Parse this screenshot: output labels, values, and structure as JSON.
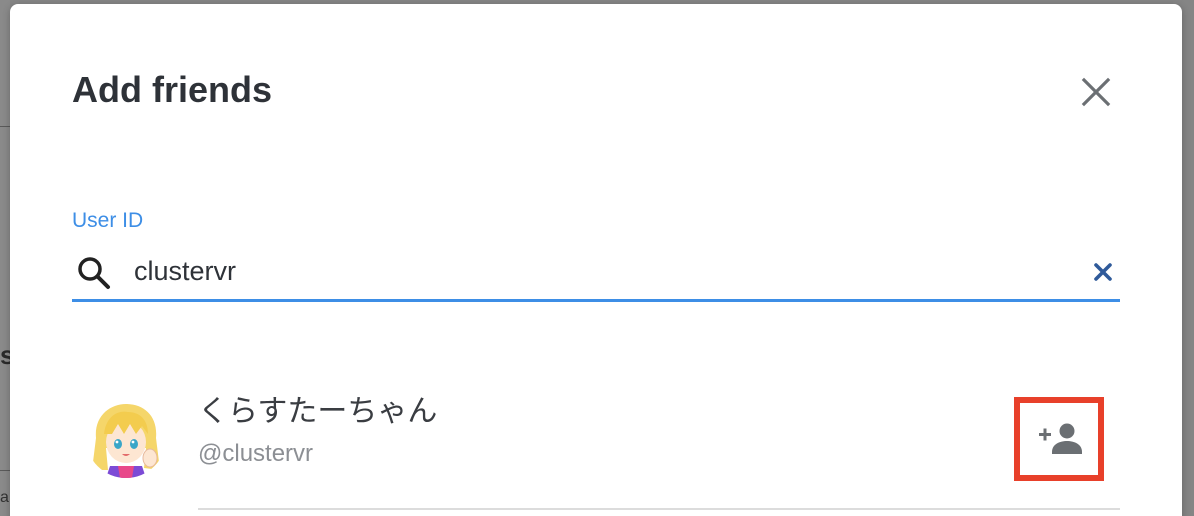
{
  "modal": {
    "title": "Add friends"
  },
  "search": {
    "label": "User ID",
    "value": "clustervr"
  },
  "results": [
    {
      "display_name": "くらすたーちゃん",
      "handle": "@clustervr"
    }
  ],
  "background": {
    "fragment_1": "s",
    "fragment_2": "a"
  },
  "icons": {
    "close": "close-icon",
    "search": "search-icon",
    "clear": "clear-icon",
    "add_friend": "person-add-icon"
  },
  "colors": {
    "accent": "#3d8ee6",
    "highlight": "#e8402a",
    "title": "#2e3238",
    "muted": "#8c8f94",
    "clear": "#2f5a9a",
    "icon": "#6b6f73"
  }
}
